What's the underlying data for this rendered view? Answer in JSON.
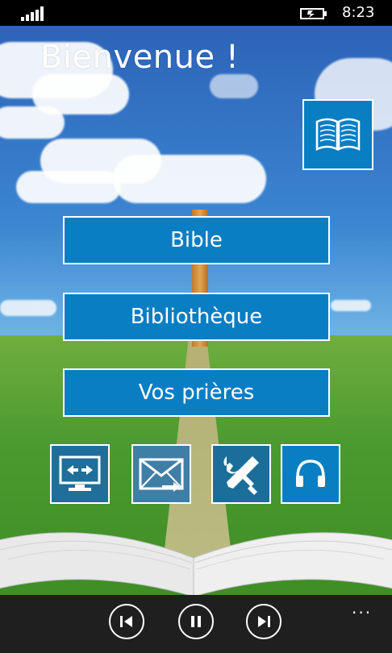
{
  "status_bar": {
    "time": "8:23"
  },
  "main": {
    "title": "Bienvenue !",
    "buttons": [
      {
        "label": "Bible"
      },
      {
        "label": "Bibliothèque"
      },
      {
        "label": "Vos prières"
      }
    ],
    "icon_tiles": [
      "monitor-arrows-icon",
      "envelope-icon",
      "tools-icon",
      "headphones-icon"
    ],
    "top_tile_icon": "open-book-icon"
  },
  "app_bar": {
    "controls": [
      "previous-icon",
      "pause-icon",
      "next-icon"
    ],
    "more": "..."
  },
  "colors": {
    "tile_blue": "#0a7ec3",
    "app_bar": "#1f1f1f",
    "status_bar": "#000000"
  }
}
